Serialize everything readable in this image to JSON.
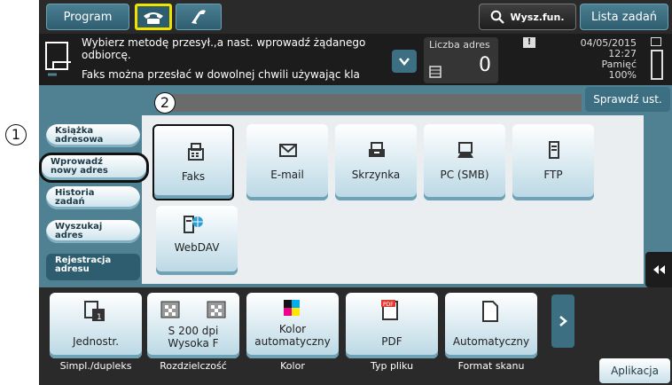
{
  "header": {
    "program_label": "Program",
    "search_label": "Wysz.fun.",
    "job_list_label": "Lista zadań"
  },
  "info": {
    "message_line1": "Wybierz metodę przesył.,a nast. wprowadź żądanego",
    "message_line2": "odbiorcę.",
    "message_line3": "Faks można przesłać w dowolnej chwili używając kla",
    "address_count_label": "Liczba adres",
    "address_count_value": "0",
    "date": "04/05/2015",
    "time": "12:27",
    "memory_label": "Pamięć",
    "memory_value": "100%",
    "check_settings_label": "Sprawdź ust."
  },
  "callouts": {
    "one": "1",
    "two": "2"
  },
  "sidebar": {
    "items": [
      {
        "label": "Książka adresowa"
      },
      {
        "label": "Wprowadź nowy adres"
      },
      {
        "label": "Historia zadań"
      },
      {
        "label": "Wyszukaj adres"
      },
      {
        "label": "Rejestracja adresu"
      }
    ]
  },
  "destinations": [
    {
      "label": "Faks",
      "icon": "fax-icon"
    },
    {
      "label": "E-mail",
      "icon": "envelope-icon"
    },
    {
      "label": "Skrzynka",
      "icon": "box-icon"
    },
    {
      "label": "PC (SMB)",
      "icon": "computer-icon"
    },
    {
      "label": "FTP",
      "icon": "server-icon"
    },
    {
      "label": "WebDAV",
      "icon": "webdav-icon"
    }
  ],
  "settings": [
    {
      "value": "Jednostr.",
      "caption": "Simpl./dupleks"
    },
    {
      "value_line1": "S 200 dpi",
      "value_line2": "Wysoka F",
      "caption": "Rozdzielczość"
    },
    {
      "value_line1": "Kolor",
      "value_line2": "automatyczny",
      "caption": "Kolor"
    },
    {
      "value": "PDF",
      "caption": "Typ pliku"
    },
    {
      "value": "Automatyczny",
      "caption": "Format skanu"
    }
  ],
  "footer": {
    "apps_label": "Aplikacja"
  },
  "colors": {
    "highlight": "#f2e200",
    "accent": "#4f8193"
  }
}
